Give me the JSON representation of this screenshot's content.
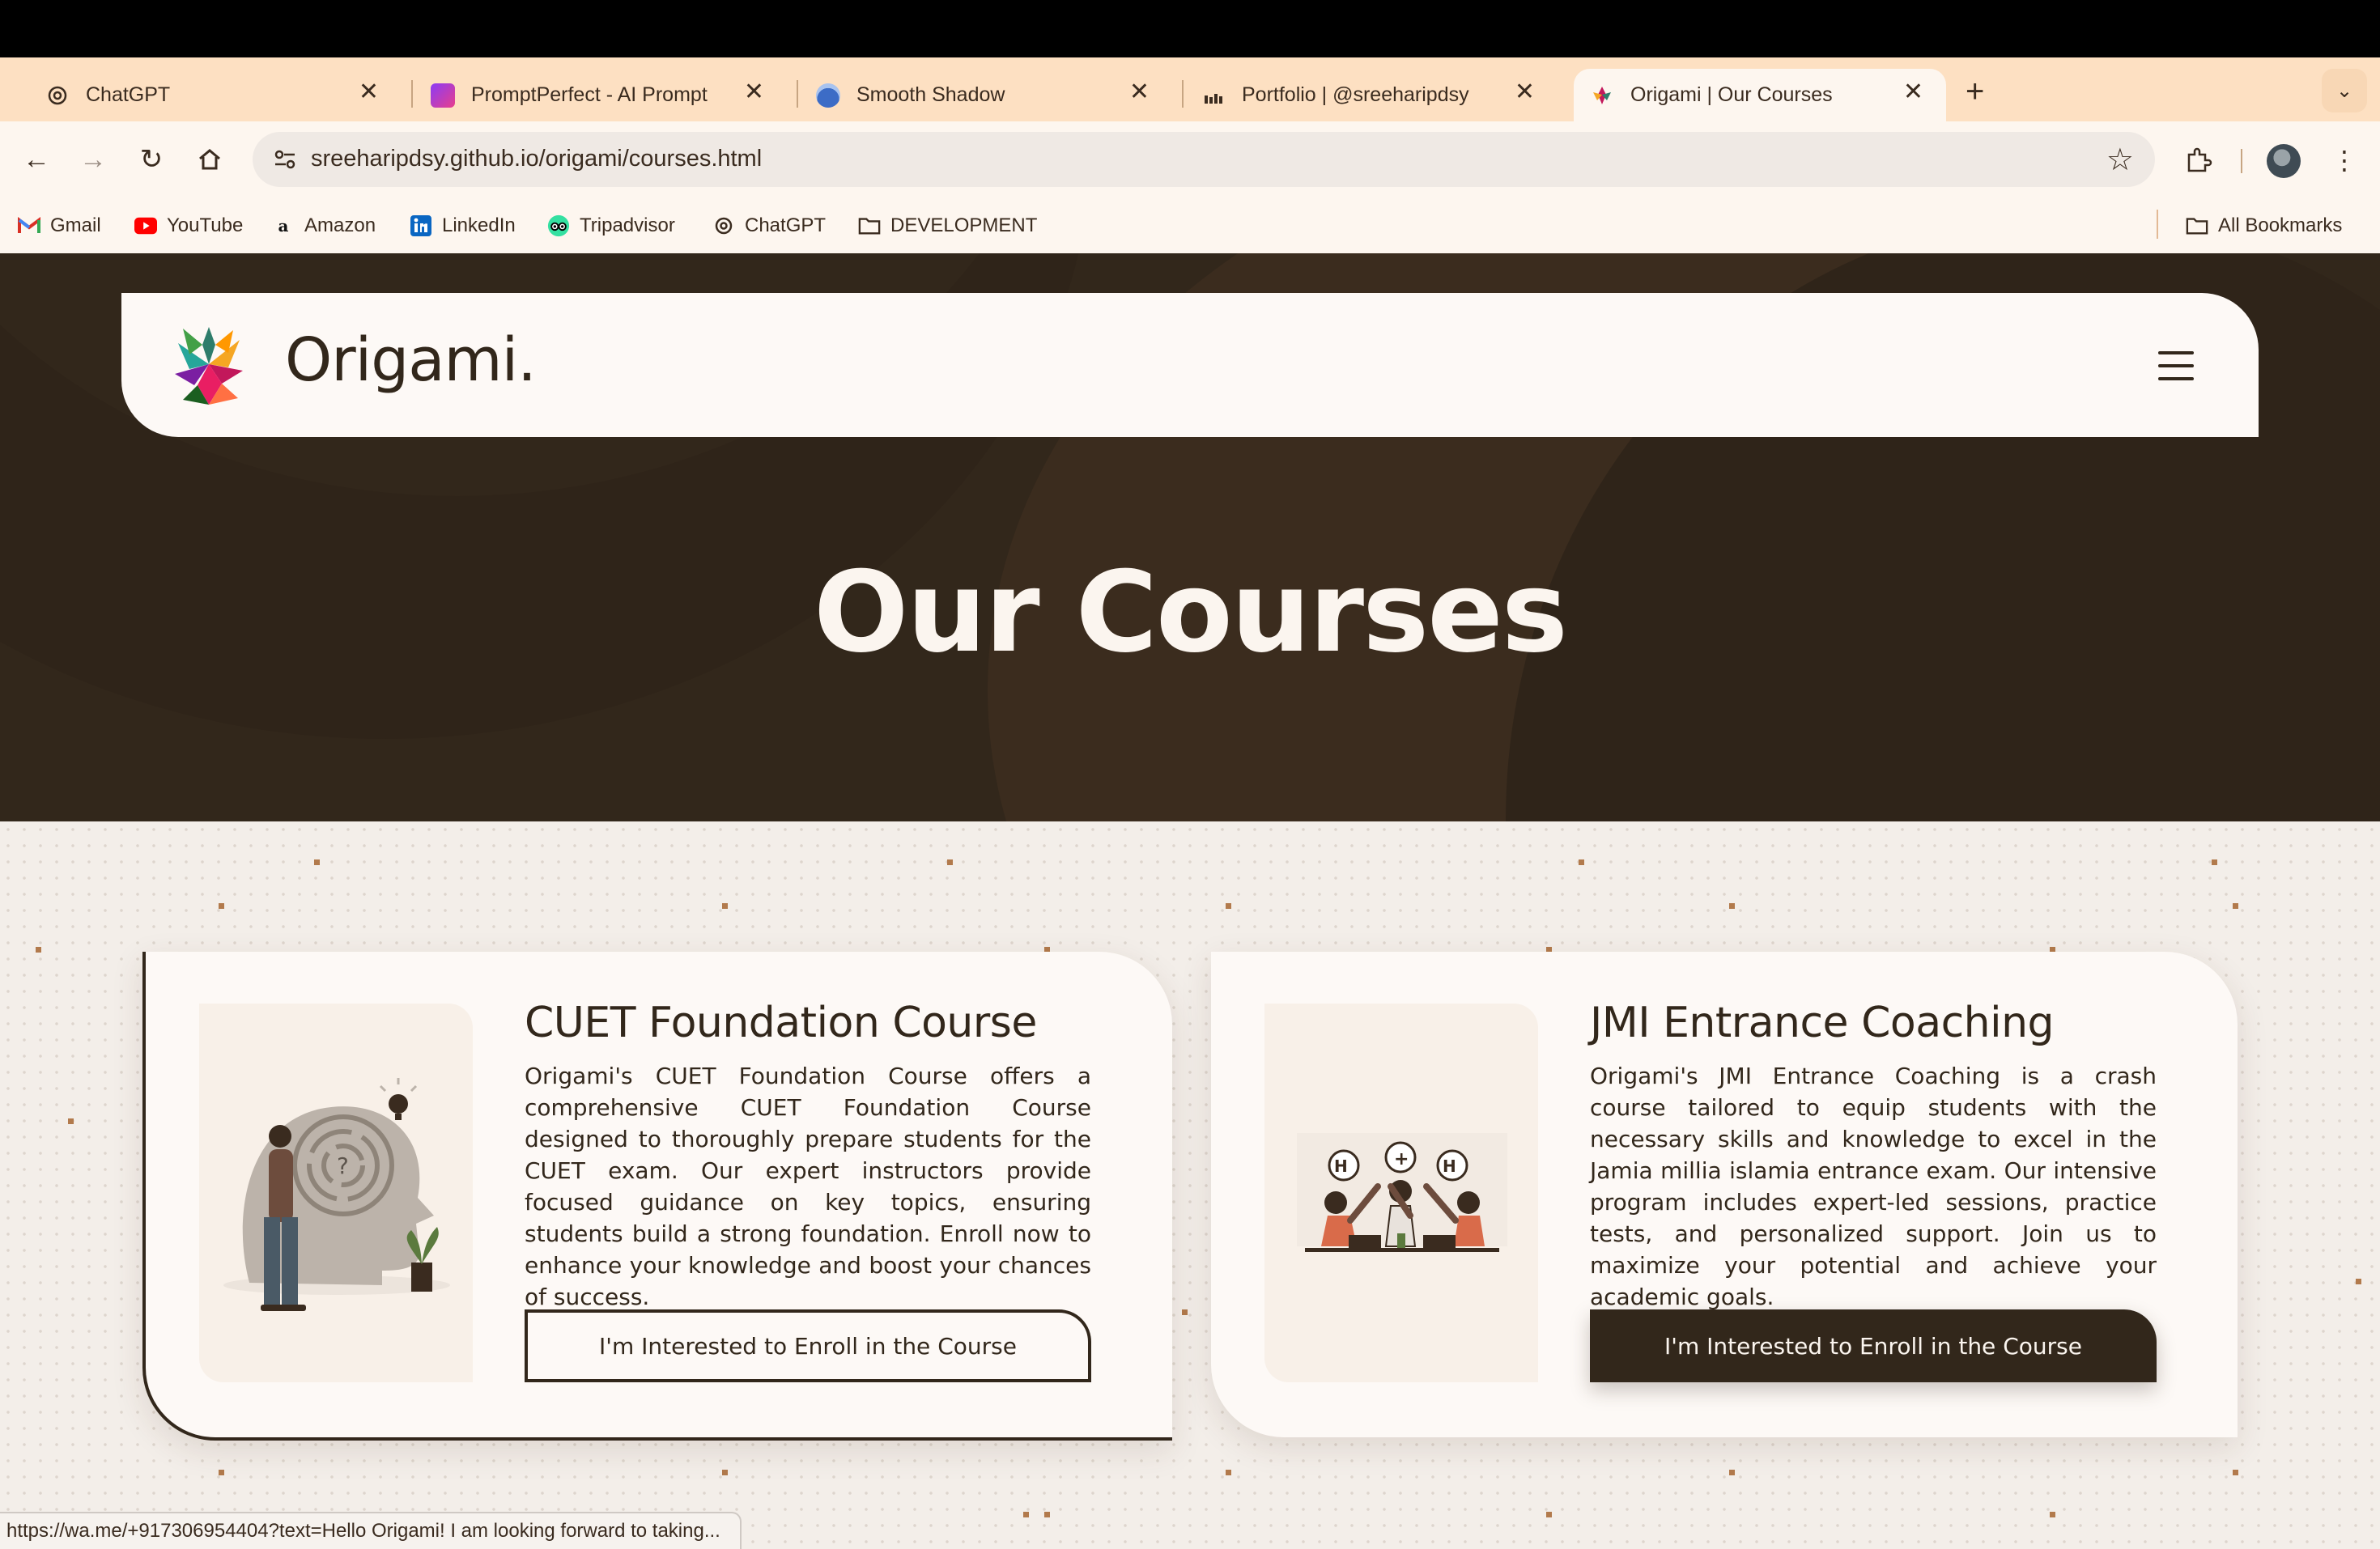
{
  "browser": {
    "tabs": [
      {
        "title": "ChatGPT",
        "icon": "chatgpt-icon",
        "active": false
      },
      {
        "title": "PromptPerfect - AI Prompt Generator",
        "icon": "promptperfect-icon",
        "active": false
      },
      {
        "title": "Smooth Shadow",
        "icon": "smooth-shadow-icon",
        "active": false
      },
      {
        "title": "Portfolio | @sreeharipdsy",
        "icon": "portfolio-icon",
        "active": false
      },
      {
        "title": "Origami | Our Courses",
        "icon": "origami-icon",
        "active": true
      }
    ],
    "url": "sreeharipdsy.github.io/origami/courses.html",
    "bookmarks": [
      {
        "label": "Gmail",
        "icon": "gmail-icon"
      },
      {
        "label": "YouTube",
        "icon": "youtube-icon"
      },
      {
        "label": "Amazon",
        "icon": "amazon-icon"
      },
      {
        "label": "LinkedIn",
        "icon": "linkedin-icon"
      },
      {
        "label": "Tripadvisor",
        "icon": "tripadvisor-icon"
      },
      {
        "label": "ChatGPT",
        "icon": "chatgpt-icon"
      },
      {
        "label": "DEVELOPMENT",
        "icon": "folder-icon"
      }
    ],
    "all_bookmarks": "All Bookmarks",
    "status_url": "https://wa.me/+917306954404?text=Hello Origami! I am looking forward to taking..."
  },
  "site": {
    "brand": "Origami.",
    "page_title": "Our Courses",
    "courses": [
      {
        "title": "CUET Foundation Course",
        "description": "Origami's CUET Foundation Course offers a comprehensive CUET Foundation Course designed to thoroughly prepare students for the CUET exam. Our expert instructors provide focused guidance on key topics, ensuring students build a strong foundation. Enroll now to enhance your knowledge and boost your chances of success.",
        "button": "I'm Interested to Enroll in the Course"
      },
      {
        "title": "JMI Entrance Coaching",
        "description": "Origami's JMI Entrance Coaching is a crash course tailored to equip students with the necessary skills and knowledge to excel in the Jamia millia islamia entrance exam. Our intensive program includes expert-led sessions, practice tests, and personalized support. Join us to maximize your potential and achieve your academic goals.",
        "button": "I'm Interested to Enroll in the Course"
      }
    ]
  },
  "colors": {
    "brand_dark": "#32271b",
    "tab_strip": "#fde0c2",
    "cream": "#fdf9f6",
    "accent_dots": "#b27a4c"
  }
}
